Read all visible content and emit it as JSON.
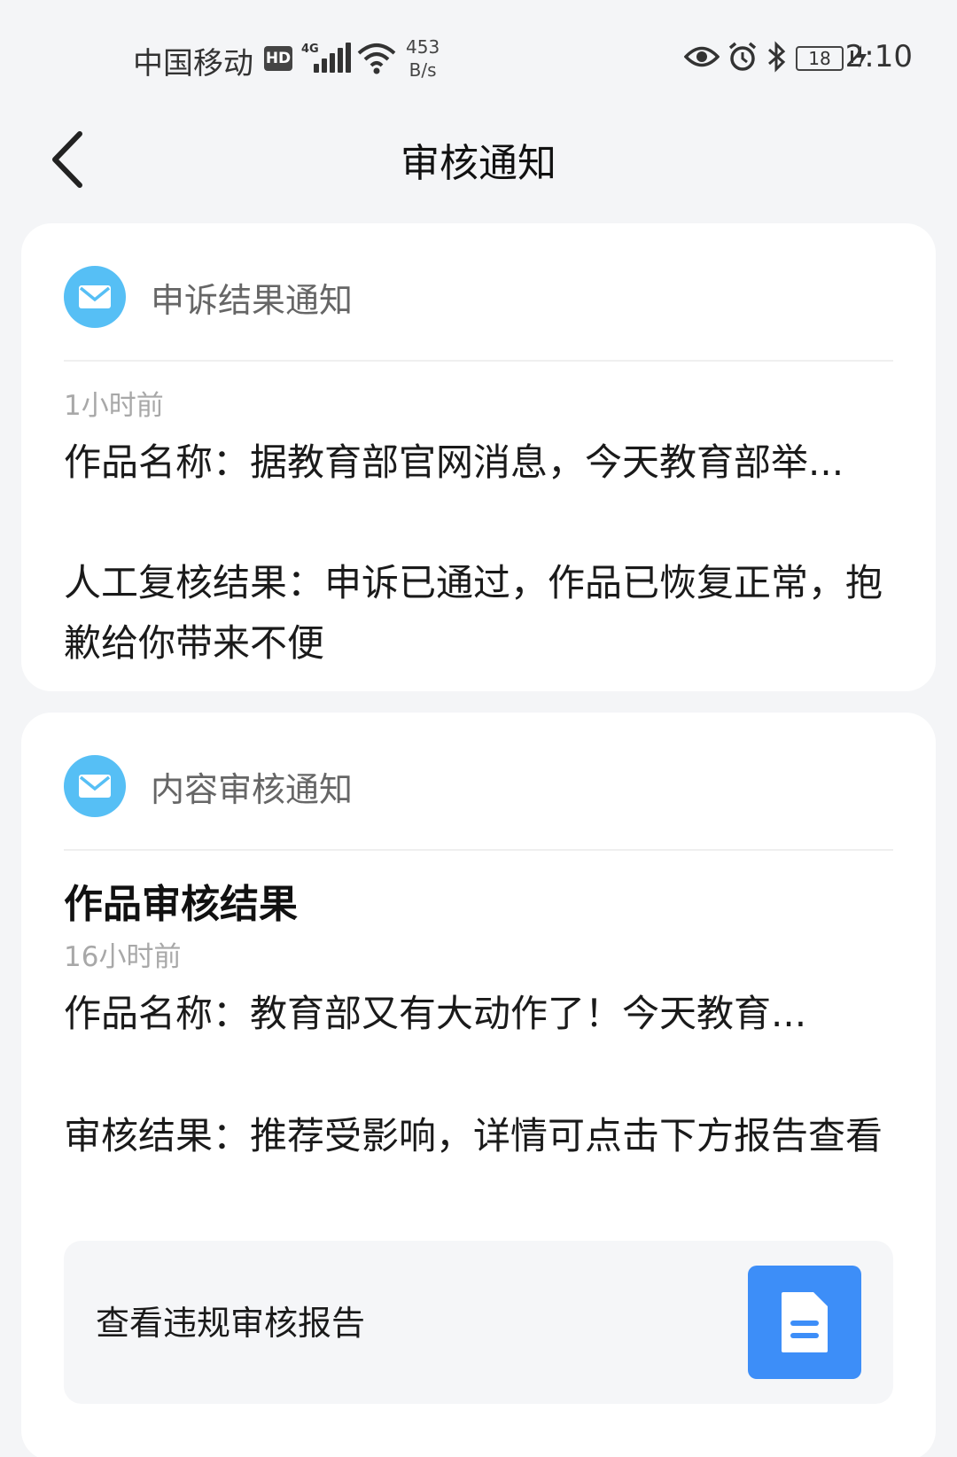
{
  "status_bar": {
    "carrier": "中国移动",
    "hd_badge": "HD",
    "network_type": "4G",
    "speed_value": "453",
    "speed_unit": "B/s",
    "battery": "18",
    "time": "2:10"
  },
  "nav": {
    "title": "审核通知"
  },
  "cards": [
    {
      "title": "申诉结果通知",
      "time": "1小时前",
      "line1": "作品名称：据教育部官网消息，今天教育部举...",
      "line2": "人工复核结果：申诉已通过，作品已恢复正常，抱歉给你带来不便"
    },
    {
      "title": "内容审核通知",
      "heading": "作品审核结果",
      "time": "16小时前",
      "line1": "作品名称：教育部又有大动作了！今天教育...",
      "line2": "审核结果：推荐受影响，详情可点击下方报告查看",
      "report_label": "查看违规审核报告"
    }
  ],
  "colors": {
    "page_bg": "#f4f5f7",
    "mail_icon_bg": "#56bff5",
    "report_icon_bg": "#3d8ef8"
  },
  "icons": {
    "back": "chevron-left-icon",
    "mail": "mail-icon",
    "report": "document-icon"
  }
}
